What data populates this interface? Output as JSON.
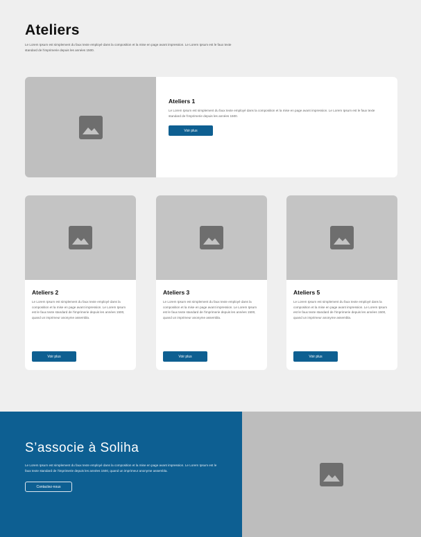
{
  "header": {
    "title": "Ateliers",
    "intro": "Le Lorem Ipsum est simplement du faux texte employé dans la composition et la mise en page avant impression. Le Lorem Ipsum est le faux texte standard de l'imprimerie depuis les années 1500."
  },
  "featured": {
    "title": "Ateliers 1",
    "text": "Le Lorem Ipsum est simplement du faux texte employé dans la composition et la mise en page avant impression. Le Lorem Ipsum est le faux texte standard de l'imprimerie depuis les années 1500.",
    "button": "Voir plus",
    "image_icon": "image-placeholder-icon"
  },
  "cards": [
    {
      "title": "Ateliers 2",
      "text": "Le Lorem Ipsum est simplement du faux texte employé dans la composition et la mise en page avant impression. Le Lorem Ipsum est le faux texte standard de l'imprimerie depuis les années 1500, quand un imprimeur anonyme assembla.",
      "button": "Voir plus"
    },
    {
      "title": "Ateliers 3",
      "text": "Le Lorem Ipsum est simplement du faux texte employé dans la composition et la mise en page avant impression. Le Lorem Ipsum est le faux texte standard de l'imprimerie depuis les années 1500, quand un imprimeur anonyme assembla.",
      "button": "Voir plus"
    },
    {
      "title": "Ateliers 5",
      "text": "Le Lorem Ipsum est simplement du faux texte employé dans la composition et la mise en page avant impression. Le Lorem Ipsum est le faux texte standard de l'imprimerie depuis les années 1500, quand un imprimeur anonyme assembla.",
      "button": "Voir plus"
    }
  ],
  "partner": {
    "title": "S’associe à Soliha",
    "text": "Le Lorem Ipsum est simplement du faux texte employé dans la composition et la mise en page avant impression. Le Lorem Ipsum est le faux texte standard de l'imprimerie depuis les années 1500, quand un imprimeur anonyme assembla.",
    "button": "Contactez-nous"
  },
  "colors": {
    "accent": "#0e5f91",
    "page_background": "#efefef",
    "placeholder": "#c4c4c4",
    "placeholder_icon": "#6e6e6e"
  }
}
